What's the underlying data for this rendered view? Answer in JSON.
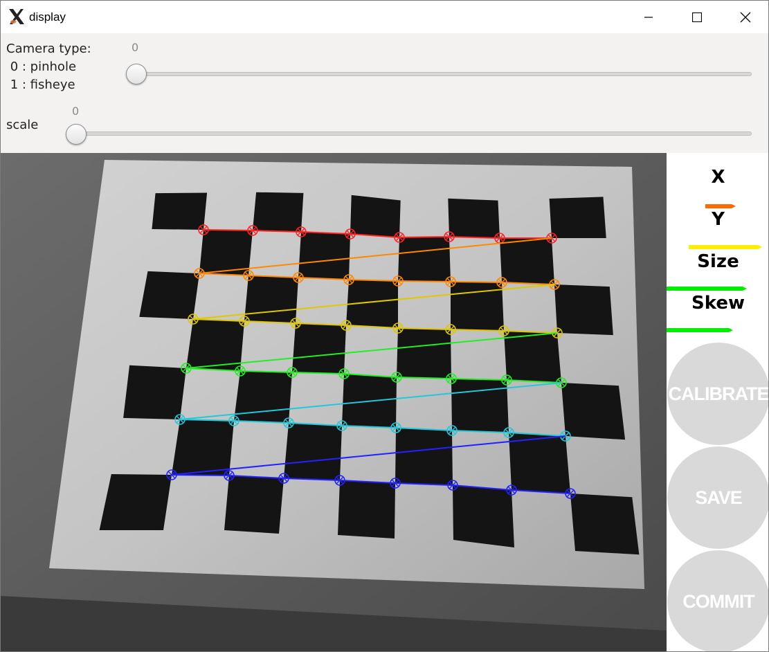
{
  "window": {
    "title": "display"
  },
  "controls": {
    "camera_type": {
      "label": "Camera type:\n 0 : pinhole\n 1 : fisheye",
      "value": "0"
    },
    "scale": {
      "label": "scale",
      "value": "0"
    }
  },
  "panel": {
    "x_label": "X",
    "x_color": "#ff6a00",
    "y_label": "Y",
    "y_color": "#ffee00",
    "size_label": "Size",
    "size_color": "#00ee00",
    "skew_label": "Skew",
    "skew_color": "#00ee00",
    "calibrate_label": "CALIBRATE",
    "save_label": "SAVE",
    "commit_label": "COMMIT"
  },
  "detection": {
    "rows": [
      {
        "color": "#ff2222"
      },
      {
        "color": "#ff8800"
      },
      {
        "color": "#e0c800"
      },
      {
        "color": "#22ee22"
      },
      {
        "color": "#22c8d8"
      },
      {
        "color": "#2222ff"
      }
    ],
    "corners_per_row": 8
  }
}
